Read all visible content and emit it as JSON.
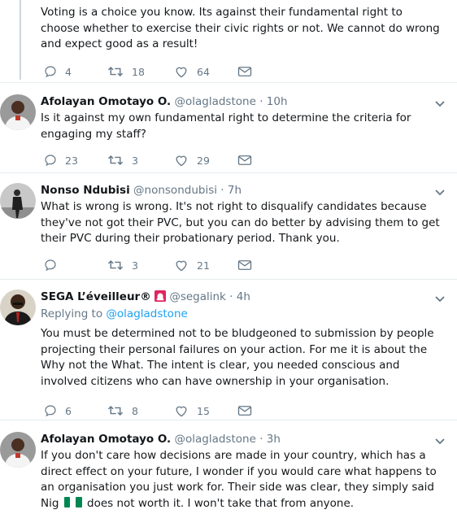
{
  "tweets": [
    {
      "text": "Voting is a choice you know. Its against their fundamental right to choose whether to exercise their civic rights or not. We cannot do wrong and expect good as a result!",
      "replies": "4",
      "retweets": "18",
      "likes": "64"
    },
    {
      "name": "Afolayan Omotayo O.",
      "handle": "@olagladstone",
      "time": "10h",
      "text": "Is it against my own fundamental right to determine the criteria for engaging my staff?",
      "replies": "23",
      "retweets": "3",
      "likes": "29"
    },
    {
      "name": "Nonso Ndubisi",
      "handle": "@nonsondubisi",
      "time": "7h",
      "text": "What is wrong is wrong. It's not right to disqualify candidates because they've not got their PVC, but you can do better by advising them to get their PVC during their probationary period. Thank you.",
      "replies": "",
      "retweets": "3",
      "likes": "21"
    },
    {
      "name": "SEGA L’éveilleur®",
      "handle": "@segalink",
      "time": "4h",
      "replying_label": "Replying to",
      "replying_handle": "@olagladstone",
      "text": "You must be determined not to be bludgeoned to submission by people projecting their personal failures on your action. For me it is about the Why not the What. The intent is clear, you needed conscious and involved citizens who can have ownership in your organisation.",
      "replies": "6",
      "retweets": "8",
      "likes": "15"
    },
    {
      "name": "Afolayan Omotayo O.",
      "handle": "@olagladstone",
      "time": "3h",
      "text_before_flag": "If you don't care how decisions are made in your country, which has a direct effect on your future, I wonder if you would care what happens to an organisation you just work for. Their side was clear, they simply said Nig",
      "text_after_flag": "does not worth it. I won't take that from anyone."
    }
  ],
  "icons": {
    "reply": "reply-icon",
    "retweet": "retweet-icon",
    "like": "heart-icon",
    "dm": "envelope-icon",
    "caret": "chevron-down-icon",
    "siren": "siren-emoji",
    "flag": "nigeria-flag-emoji"
  },
  "colors": {
    "muted": "#657786",
    "link": "#1da1f2",
    "separator": "#e6ecf0",
    "flag_green": "#008751"
  }
}
